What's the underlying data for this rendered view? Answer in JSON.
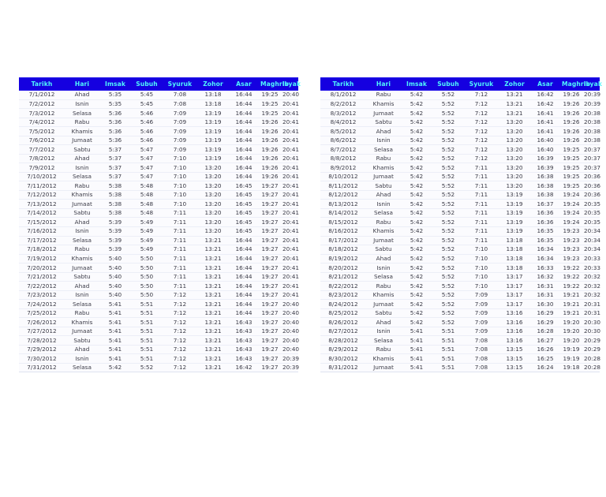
{
  "colors": {
    "header_bg": "#1500e0",
    "header_text": "#4ff7fb",
    "row_bg": "#fbfbfe",
    "row_text": "#3a3a46",
    "page_bg": "#ffffff"
  },
  "columns": [
    "Tarikh",
    "Hari",
    "Imsak",
    "Subuh",
    "Syuruk",
    "Zohor",
    "Asar",
    "Maghrib",
    "Isyak"
  ],
  "tables": [
    {
      "id": "july-2012",
      "columns": [
        "Tarikh",
        "Hari",
        "Imsak",
        "Subuh",
        "Syuruk",
        "Zohor",
        "Asar",
        "Maghrib",
        "Isyak"
      ],
      "rows": [
        [
          "7/1/2012",
          "Ahad",
          "5:35",
          "5:45",
          "7:08",
          "13:18",
          "16:44",
          "19:25",
          "20:40"
        ],
        [
          "7/2/2012",
          "Isnin",
          "5:35",
          "5:45",
          "7:08",
          "13:18",
          "16:44",
          "19:25",
          "20:41"
        ],
        [
          "7/3/2012",
          "Selasa",
          "5:36",
          "5:46",
          "7:09",
          "13:19",
          "16:44",
          "19:25",
          "20:41"
        ],
        [
          "7/4/2012",
          "Rabu",
          "5:36",
          "5:46",
          "7:09",
          "13:19",
          "16:44",
          "19:26",
          "20:41"
        ],
        [
          "7/5/2012",
          "Khamis",
          "5:36",
          "5:46",
          "7:09",
          "13:19",
          "16:44",
          "19:26",
          "20:41"
        ],
        [
          "7/6/2012",
          "Jumaat",
          "5:36",
          "5:46",
          "7:09",
          "13:19",
          "16:44",
          "19:26",
          "20:41"
        ],
        [
          "7/7/2012",
          "Sabtu",
          "5:37",
          "5:47",
          "7:09",
          "13:19",
          "16:44",
          "19:26",
          "20:41"
        ],
        [
          "7/8/2012",
          "Ahad",
          "5:37",
          "5:47",
          "7:10",
          "13:19",
          "16:44",
          "19:26",
          "20:41"
        ],
        [
          "7/9/2012",
          "Isnin",
          "5:37",
          "5:47",
          "7:10",
          "13:20",
          "16:44",
          "19:26",
          "20:41"
        ],
        [
          "7/10/2012",
          "Selasa",
          "5:37",
          "5:47",
          "7:10",
          "13:20",
          "16:44",
          "19:26",
          "20:41"
        ],
        [
          "7/11/2012",
          "Rabu",
          "5:38",
          "5:48",
          "7:10",
          "13:20",
          "16:45",
          "19:27",
          "20:41"
        ],
        [
          "7/12/2012",
          "Khamis",
          "5:38",
          "5:48",
          "7:10",
          "13:20",
          "16:45",
          "19:27",
          "20:41"
        ],
        [
          "7/13/2012",
          "Jumaat",
          "5:38",
          "5:48",
          "7:10",
          "13:20",
          "16:45",
          "19:27",
          "20:41"
        ],
        [
          "7/14/2012",
          "Sabtu",
          "5:38",
          "5:48",
          "7:11",
          "13:20",
          "16:45",
          "19:27",
          "20:41"
        ],
        [
          "7/15/2012",
          "Ahad",
          "5:39",
          "5:49",
          "7:11",
          "13:20",
          "16:45",
          "19:27",
          "20:41"
        ],
        [
          "7/16/2012",
          "Isnin",
          "5:39",
          "5:49",
          "7:11",
          "13:20",
          "16:45",
          "19:27",
          "20:41"
        ],
        [
          "7/17/2012",
          "Selasa",
          "5:39",
          "5:49",
          "7:11",
          "13:21",
          "16:44",
          "19:27",
          "20:41"
        ],
        [
          "7/18/2012",
          "Rabu",
          "5:39",
          "5:49",
          "7:11",
          "13:21",
          "16:44",
          "19:27",
          "20:41"
        ],
        [
          "7/19/2012",
          "Khamis",
          "5:40",
          "5:50",
          "7:11",
          "13:21",
          "16:44",
          "19:27",
          "20:41"
        ],
        [
          "7/20/2012",
          "Jumaat",
          "5:40",
          "5:50",
          "7:11",
          "13:21",
          "16:44",
          "19:27",
          "20:41"
        ],
        [
          "7/21/2012",
          "Sabtu",
          "5:40",
          "5:50",
          "7:11",
          "13:21",
          "16:44",
          "19:27",
          "20:41"
        ],
        [
          "7/22/2012",
          "Ahad",
          "5:40",
          "5:50",
          "7:11",
          "13:21",
          "16:44",
          "19:27",
          "20:41"
        ],
        [
          "7/23/2012",
          "Isnin",
          "5:40",
          "5:50",
          "7:12",
          "13:21",
          "16:44",
          "19:27",
          "20:41"
        ],
        [
          "7/24/2012",
          "Selasa",
          "5:41",
          "5:51",
          "7:12",
          "13:21",
          "16:44",
          "19:27",
          "20:40"
        ],
        [
          "7/25/2012",
          "Rabu",
          "5:41",
          "5:51",
          "7:12",
          "13:21",
          "16:44",
          "19:27",
          "20:40"
        ],
        [
          "7/26/2012",
          "Khamis",
          "5:41",
          "5:51",
          "7:12",
          "13:21",
          "16:43",
          "19:27",
          "20:40"
        ],
        [
          "7/27/2012",
          "Jumaat",
          "5:41",
          "5:51",
          "7:12",
          "13:21",
          "16:43",
          "19:27",
          "20:40"
        ],
        [
          "7/28/2012",
          "Sabtu",
          "5:41",
          "5:51",
          "7:12",
          "13:21",
          "16:43",
          "19:27",
          "20:40"
        ],
        [
          "7/29/2012",
          "Ahad",
          "5:41",
          "5:51",
          "7:12",
          "13:21",
          "16:43",
          "19:27",
          "20:40"
        ],
        [
          "7/30/2012",
          "Isnin",
          "5:41",
          "5:51",
          "7:12",
          "13:21",
          "16:43",
          "19:27",
          "20:39"
        ],
        [
          "7/31/2012",
          "Selasa",
          "5:42",
          "5:52",
          "7:12",
          "13:21",
          "16:42",
          "19:27",
          "20:39"
        ]
      ]
    },
    {
      "id": "august-2012",
      "columns": [
        "Tarikh",
        "Hari",
        "Imsak",
        "Subuh",
        "Syuruk",
        "Zohor",
        "Asar",
        "Maghrib",
        "Isyak"
      ],
      "rows": [
        [
          "8/1/2012",
          "Rabu",
          "5:42",
          "5:52",
          "7:12",
          "13:21",
          "16:42",
          "19:26",
          "20:39"
        ],
        [
          "8/2/2012",
          "Khamis",
          "5:42",
          "5:52",
          "7:12",
          "13:21",
          "16:42",
          "19:26",
          "20:39"
        ],
        [
          "8/3/2012",
          "Jumaat",
          "5:42",
          "5:52",
          "7:12",
          "13:21",
          "16:41",
          "19:26",
          "20:38"
        ],
        [
          "8/4/2012",
          "Sabtu",
          "5:42",
          "5:52",
          "7:12",
          "13:20",
          "16:41",
          "19:26",
          "20:38"
        ],
        [
          "8/5/2012",
          "Ahad",
          "5:42",
          "5:52",
          "7:12",
          "13:20",
          "16:41",
          "19:26",
          "20:38"
        ],
        [
          "8/6/2012",
          "Isnin",
          "5:42",
          "5:52",
          "7:12",
          "13:20",
          "16:40",
          "19:26",
          "20:38"
        ],
        [
          "8/7/2012",
          "Selasa",
          "5:42",
          "5:52",
          "7:12",
          "13:20",
          "16:40",
          "19:25",
          "20:37"
        ],
        [
          "8/8/2012",
          "Rabu",
          "5:42",
          "5:52",
          "7:12",
          "13:20",
          "16:39",
          "19:25",
          "20:37"
        ],
        [
          "8/9/2012",
          "Khamis",
          "5:42",
          "5:52",
          "7:11",
          "13:20",
          "16:39",
          "19:25",
          "20:37"
        ],
        [
          "8/10/2012",
          "Jumaat",
          "5:42",
          "5:52",
          "7:11",
          "13:20",
          "16:38",
          "19:25",
          "20:36"
        ],
        [
          "8/11/2012",
          "Sabtu",
          "5:42",
          "5:52",
          "7:11",
          "13:20",
          "16:38",
          "19:25",
          "20:36"
        ],
        [
          "8/12/2012",
          "Ahad",
          "5:42",
          "5:52",
          "7:11",
          "13:19",
          "16:38",
          "19:24",
          "20:36"
        ],
        [
          "8/13/2012",
          "Isnin",
          "5:42",
          "5:52",
          "7:11",
          "13:19",
          "16:37",
          "19:24",
          "20:35"
        ],
        [
          "8/14/2012",
          "Selasa",
          "5:42",
          "5:52",
          "7:11",
          "13:19",
          "16:36",
          "19:24",
          "20:35"
        ],
        [
          "8/15/2012",
          "Rabu",
          "5:42",
          "5:52",
          "7:11",
          "13:19",
          "16:36",
          "19:24",
          "20:35"
        ],
        [
          "8/16/2012",
          "Khamis",
          "5:42",
          "5:52",
          "7:11",
          "13:19",
          "16:35",
          "19:23",
          "20:34"
        ],
        [
          "8/17/2012",
          "Jumaat",
          "5:42",
          "5:52",
          "7:11",
          "13:18",
          "16:35",
          "19:23",
          "20:34"
        ],
        [
          "8/18/2012",
          "Sabtu",
          "5:42",
          "5:52",
          "7:10",
          "13:18",
          "16:34",
          "19:23",
          "20:34"
        ],
        [
          "8/19/2012",
          "Ahad",
          "5:42",
          "5:52",
          "7:10",
          "13:18",
          "16:34",
          "19:23",
          "20:33"
        ],
        [
          "8/20/2012",
          "Isnin",
          "5:42",
          "5:52",
          "7:10",
          "13:18",
          "16:33",
          "19:22",
          "20:33"
        ],
        [
          "8/21/2012",
          "Selasa",
          "5:42",
          "5:52",
          "7:10",
          "13:17",
          "16:32",
          "19:22",
          "20:32"
        ],
        [
          "8/22/2012",
          "Rabu",
          "5:42",
          "5:52",
          "7:10",
          "13:17",
          "16:31",
          "19:22",
          "20:32"
        ],
        [
          "8/23/2012",
          "Khamis",
          "5:42",
          "5:52",
          "7:09",
          "13:17",
          "16:31",
          "19:21",
          "20:32"
        ],
        [
          "8/24/2012",
          "Jumaat",
          "5:42",
          "5:52",
          "7:09",
          "13:17",
          "16:30",
          "19:21",
          "20:31"
        ],
        [
          "8/25/2012",
          "Sabtu",
          "5:42",
          "5:52",
          "7:09",
          "13:16",
          "16:29",
          "19:21",
          "20:31"
        ],
        [
          "8/26/2012",
          "Ahad",
          "5:42",
          "5:52",
          "7:09",
          "13:16",
          "16:29",
          "19:20",
          "20:30"
        ],
        [
          "8/27/2012",
          "Isnin",
          "5:41",
          "5:51",
          "7:09",
          "13:16",
          "16:28",
          "19:20",
          "20:30"
        ],
        [
          "8/28/2012",
          "Selasa",
          "5:41",
          "5:51",
          "7:08",
          "13:16",
          "16:27",
          "19:20",
          "20:29"
        ],
        [
          "8/29/2012",
          "Rabu",
          "5:41",
          "5:51",
          "7:08",
          "13:15",
          "16:26",
          "19:19",
          "20:29"
        ],
        [
          "8/30/2012",
          "Khamis",
          "5:41",
          "5:51",
          "7:08",
          "13:15",
          "16:25",
          "19:19",
          "20:28"
        ],
        [
          "8/31/2012",
          "Jumaat",
          "5:41",
          "5:51",
          "7:08",
          "13:15",
          "16:24",
          "19:18",
          "20:28"
        ]
      ]
    }
  ]
}
